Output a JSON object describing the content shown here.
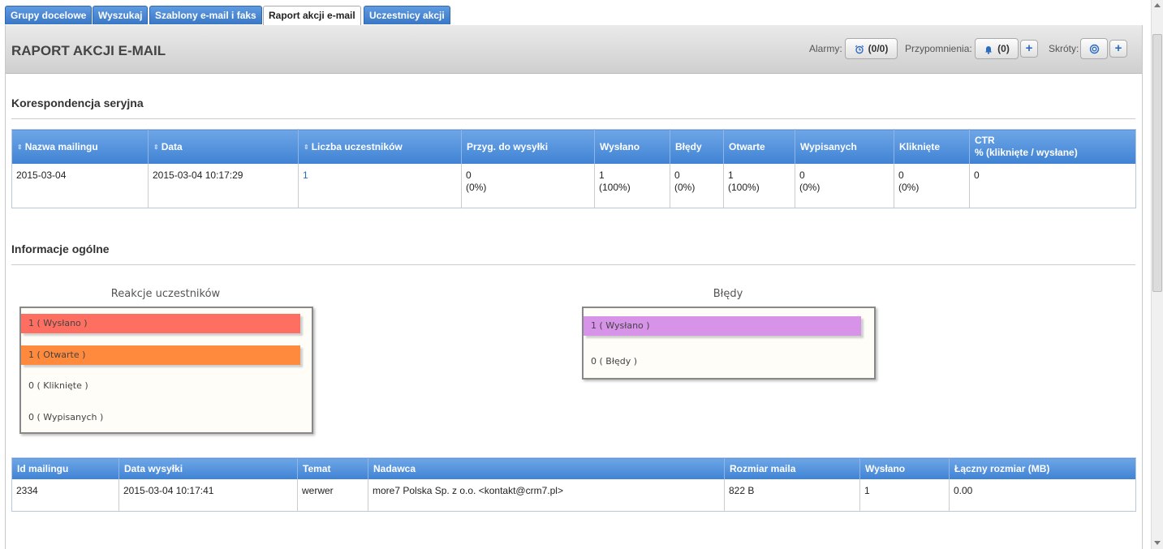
{
  "tabs": [
    {
      "label": "Grupy docelowe",
      "active": false
    },
    {
      "label": "Wyszukaj",
      "active": false
    },
    {
      "label": "Szablony e-mail i faks",
      "active": false
    },
    {
      "label": "Raport akcji e-mail",
      "active": true
    },
    {
      "label": "Uczestnicy akcji",
      "active": false
    }
  ],
  "header": {
    "title": "RAPORT AKCJI E-MAIL",
    "alarms_label": "Alarmy:",
    "alarms_value": "(0/0)",
    "reminders_label": "Przypomnienia:",
    "reminders_value": "(0)",
    "shortcuts_label": "Skróty:",
    "plus_label": "+",
    "icons": {
      "alarm": "alarm-clock-icon",
      "reminder": "bell-icon",
      "shortcut": "target-icon"
    }
  },
  "serial": {
    "title": "Korespondencja seryjna",
    "columns": [
      "Nazwa mailingu",
      "Data",
      "Liczba uczestników",
      "Przyg. do wysyłki",
      "Wysłano",
      "Błędy",
      "Otwarte",
      "Wypisanych",
      "Kliknięte",
      "CTR",
      "% (kliknięte / wysłane)"
    ],
    "sort_icon": "⇕",
    "row": {
      "name": "2015-03-04",
      "date": "2015-03-04 10:17:29",
      "participants": "1",
      "prepared": "0",
      "prepared_pct": "(0%)",
      "sent": "1",
      "sent_pct": "(100%)",
      "errors": "0",
      "errors_pct": "(0%)",
      "opened": "1",
      "opened_pct": "(100%)",
      "unsubscribed": "0",
      "unsubscribed_pct": "(0%)",
      "clicked": "0",
      "clicked_pct": "(0%)",
      "ctr": "0"
    }
  },
  "general": {
    "title": "Informacje ogólne"
  },
  "reactions": {
    "title": "Reakcje uczestników",
    "items": [
      {
        "label": "1 ( Wysłano )",
        "value": 1,
        "color": "#ff6f61"
      },
      {
        "label": "1 ( Otwarte )",
        "value": 1,
        "color": "#ff8a3d"
      },
      {
        "label": "0 ( Kliknięte )",
        "value": 0,
        "color": ""
      },
      {
        "label": "0 ( Wypisanych )",
        "value": 0,
        "color": ""
      }
    ]
  },
  "errors_chart": {
    "title": "Błędy",
    "items": [
      {
        "label": "1 ( Wysłano )",
        "value": 1,
        "color": "#d693e8"
      },
      {
        "label": "0 ( Błędy )",
        "value": 0,
        "color": ""
      }
    ]
  },
  "mailing": {
    "columns": [
      "Id mailingu",
      "Data wysyłki",
      "Temat",
      "Nadawca",
      "Rozmiar maila",
      "Wysłano",
      "Łączny rozmiar (MB)"
    ],
    "row": {
      "id": "2334",
      "date": "2015-03-04 10:17:41",
      "subject": "werwer",
      "sender": "more7 Polska Sp. z o.o. <kontakt@crm7.pl>",
      "size": "822 B",
      "sent": "1",
      "total": "0.00"
    }
  }
}
